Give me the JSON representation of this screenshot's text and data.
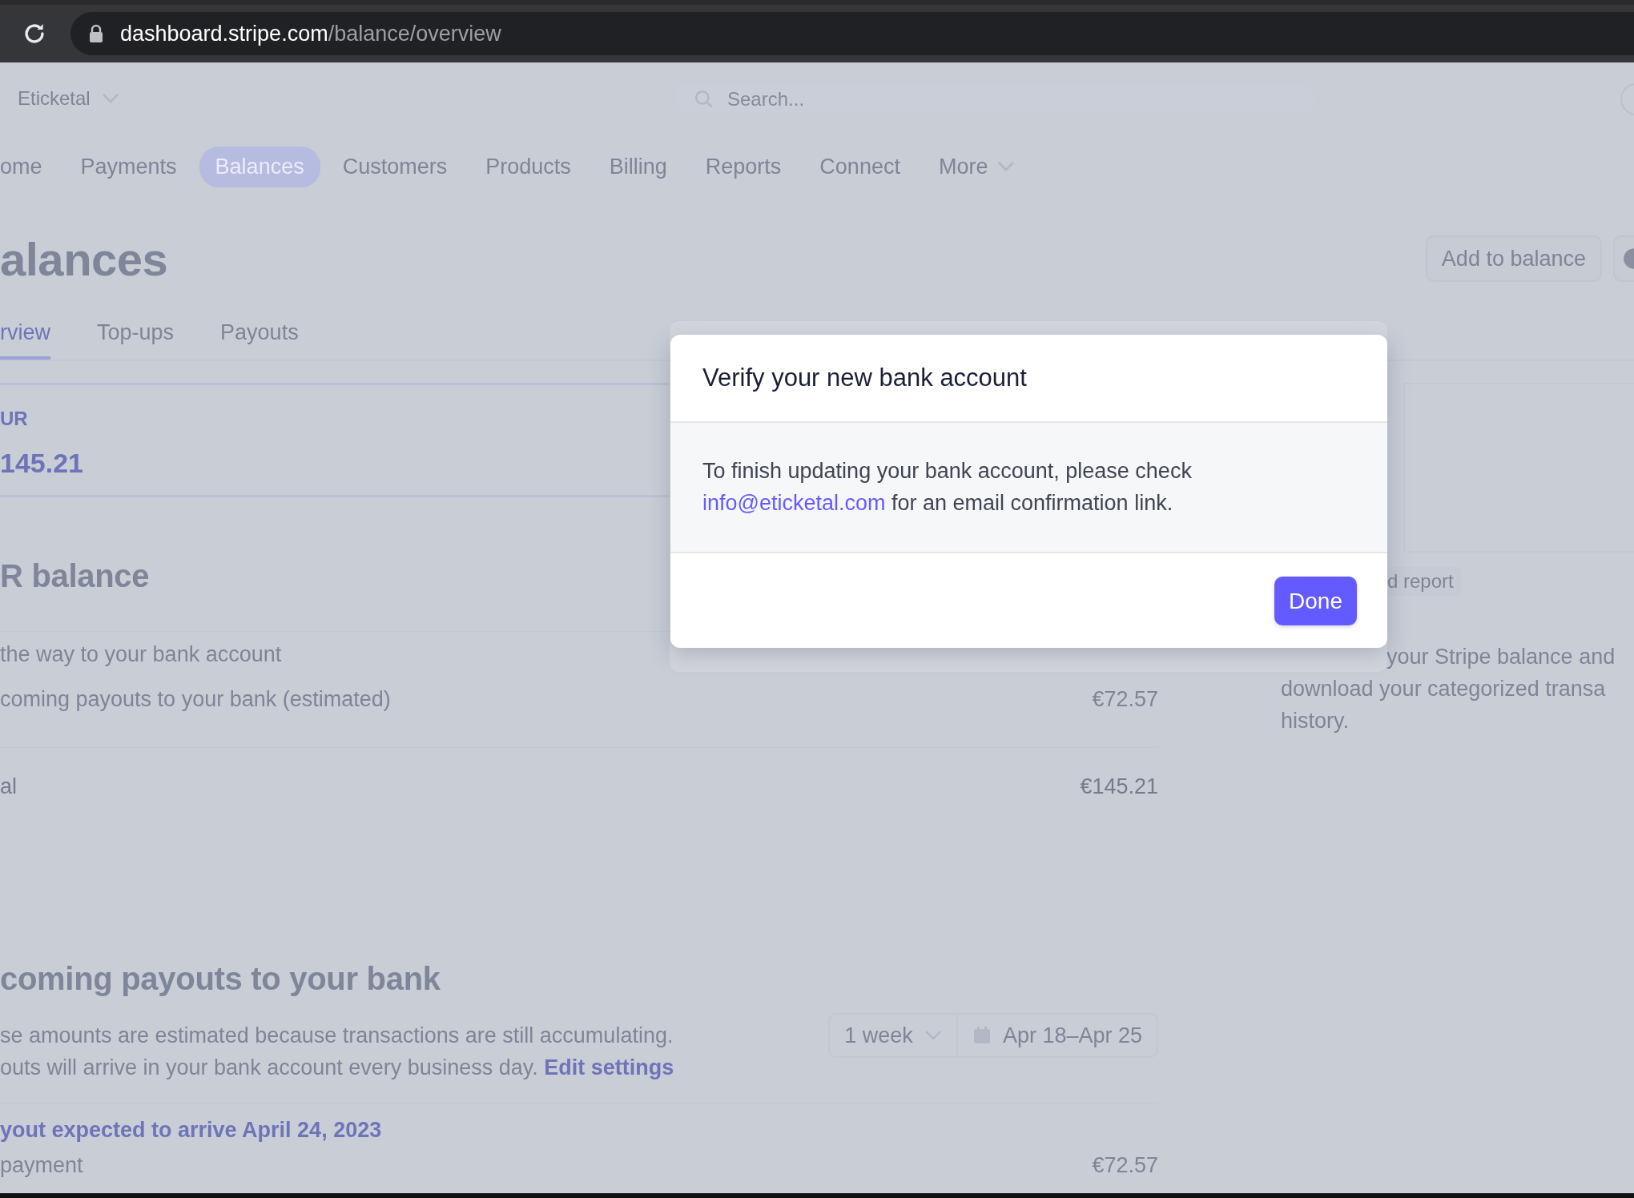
{
  "browser": {
    "url_host": "dashboard.stripe.com",
    "url_path": "/balance/overview"
  },
  "top_bar": {
    "account": "Eticketal",
    "search": {
      "placeholder": "Search..."
    }
  },
  "nav": [
    {
      "label": "ome",
      "selected": false,
      "kind": "link"
    },
    {
      "label": "Payments",
      "selected": false,
      "kind": "link"
    },
    {
      "label": "Balances",
      "selected": true,
      "kind": "link"
    },
    {
      "label": "Customers",
      "selected": false,
      "kind": "link"
    },
    {
      "label": "Products",
      "selected": false,
      "kind": "link"
    },
    {
      "label": "Billing",
      "selected": false,
      "kind": "link"
    },
    {
      "label": "Reports",
      "selected": false,
      "kind": "link"
    },
    {
      "label": "Connect",
      "selected": false,
      "kind": "link"
    },
    {
      "label": "More",
      "selected": false,
      "kind": "dropdown"
    }
  ],
  "page": {
    "title": "alances",
    "actions": [
      "Add to balance"
    ]
  },
  "tabs": [
    {
      "label": "rview",
      "selected": true
    },
    {
      "label": "Top-ups",
      "selected": false
    },
    {
      "label": "Payouts",
      "selected": false
    }
  ],
  "balance_card": {
    "currency": "UR",
    "amount": "145.21"
  },
  "balance_section": {
    "title": "R balance",
    "rows": [
      {
        "label": "the way to your bank account",
        "total": false
      },
      {
        "label": "coming payouts to your bank (estimated)",
        "amount": "€72.57",
        "total": false
      },
      {
        "label": "al",
        "amount": "€145.21",
        "total": true
      }
    ]
  },
  "side_panel": {
    "button": "d report",
    "text_lines": [
      "your Stripe balance and",
      "download your categorized transa",
      "history."
    ]
  },
  "payouts": {
    "title": "coming payouts to your bank",
    "description_lines": [
      "se amounts are estimated because transactions are still accumulating.",
      "outs will arrive in your bank account every business day."
    ],
    "link": "Edit settings",
    "range": "1 week",
    "dates": "Apr 18–Apr 25",
    "group_title": "yout expected to arrive April 24, 2023",
    "rows": [
      {
        "label": "payment",
        "amount": "€72.57"
      }
    ]
  },
  "modal": {
    "title": "Verify your new bank account",
    "message_line_1": "To finish updating your bank account, please check",
    "email": "info@eticketal.com",
    "message_after": "for an email confirmation link.",
    "button": "Done"
  }
}
